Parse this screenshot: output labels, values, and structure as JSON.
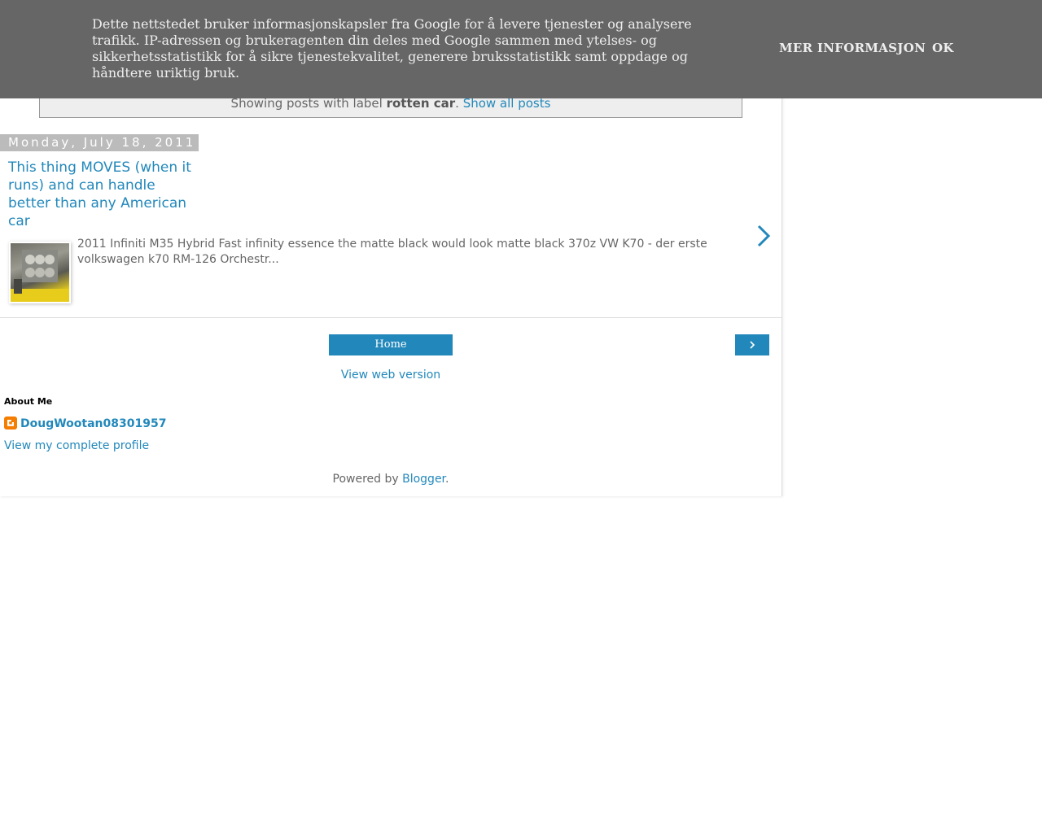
{
  "cookie_notice": {
    "text": "Dette nettstedet bruker informasjonskapsler fra Google for å levere tjenester og analysere trafikk. IP-adressen og brukeragenten din deles med Google sammen med ytelses- og sikkerhetsstatistikk for å sikre tjenestekvalitet, generere bruksstatistikk samt oppdage og håndtere uriktig bruk.",
    "more_info_label": "MER INFORMASJON",
    "ok_label": "OK"
  },
  "status": {
    "prefix": "Showing posts with label ",
    "label": "rotten car",
    "suffix": ". ",
    "show_all": "Show all posts"
  },
  "post": {
    "date": "Monday, July 18, 2011",
    "title": "This thing MOVES (when it runs) and can handle better than any American car",
    "snippet": "2011 Infiniti M35 Hybrid Fast infinity essence the matte black would look matte black 370z VW K70 - der erste volkswagen k70 RM-126 Orchestr...",
    "thumbnail_icon": "car-engine-thumbnail",
    "arrow_icon": "chevron-right-icon"
  },
  "pager": {
    "home_label": "Home",
    "older_icon": "chevron-right-icon",
    "web_version": "View web version"
  },
  "about": {
    "title": "About Me",
    "name": "DougWootan08301957",
    "profile_link": "View my complete profile",
    "icon": "blogger-icon"
  },
  "footer": {
    "powered_prefix": "Powered by ",
    "powered_link": "Blogger",
    "powered_suffix": "."
  },
  "colors": {
    "link": "#2288bb",
    "cookie_bar": "#666666",
    "date_header": "#bbbbbb",
    "blogger_orange": "#f57d00"
  }
}
